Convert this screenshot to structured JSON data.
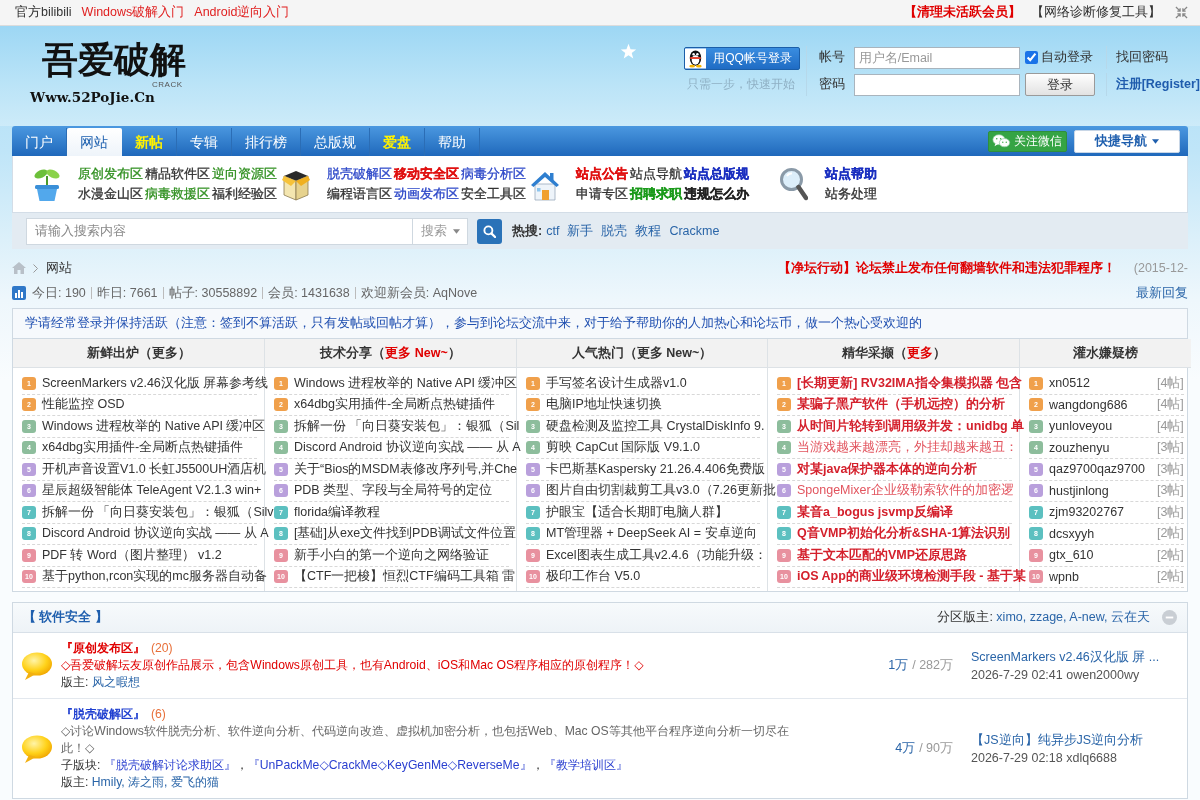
{
  "top_bar": {
    "links": [
      {
        "label": "官方bilibili",
        "color": "#333333"
      },
      {
        "label": "Windows破解入门",
        "color": "#e02020"
      },
      {
        "label": "Android逆向入门",
        "color": "#e02020"
      }
    ],
    "tools": [
      {
        "label": "【清理未活跃会员】",
        "color": "#e00000",
        "bold": true
      },
      {
        "label": "【网络诊断修复工具】",
        "color": "#333333",
        "bold": false
      }
    ]
  },
  "logo": {
    "title": "吾爱破解",
    "tag": "CRACK",
    "domain": "Www.52PoJie.Cn"
  },
  "qq_login": {
    "button": "用QQ帐号登录",
    "hint": "只需一步，快速开始"
  },
  "login": {
    "account_label": "帐号",
    "account_placeholder": "用户名/Email",
    "remember": {
      "label": "自动登录",
      "checked": true
    },
    "forgot": "找回密码",
    "password_label": "密码",
    "submit": "登录",
    "register": "注册[Register]"
  },
  "nav": {
    "items": [
      {
        "label": "门户",
        "selected": false,
        "highlight": false
      },
      {
        "label": "网站",
        "selected": true,
        "highlight": false
      },
      {
        "label": "新帖",
        "selected": false,
        "highlight": true
      },
      {
        "label": "专辑",
        "selected": false,
        "highlight": false
      },
      {
        "label": "排行榜",
        "selected": false,
        "highlight": false
      },
      {
        "label": "总版规",
        "selected": false,
        "highlight": false
      },
      {
        "label": "爱盘",
        "selected": false,
        "highlight": true
      },
      {
        "label": "帮助",
        "selected": false,
        "highlight": false
      }
    ],
    "wechat": "关注微信",
    "quick_nav": "快捷导航"
  },
  "categories": [
    {
      "rows": [
        [
          {
            "label": "原创发布区",
            "color": "#2f8f1f",
            "bold": false
          },
          {
            "label": "精品软件区",
            "color": "#333333",
            "bold": false
          },
          {
            "label": "逆向资源区",
            "color": "#2f8f1f",
            "bold": false
          }
        ],
        [
          {
            "label": "水漫金山区",
            "color": "#333333",
            "bold": false
          },
          {
            "label": "病毒救援区",
            "color": "#2f8f1f",
            "bold": false
          },
          {
            "label": "福利经验区",
            "color": "#333333",
            "bold": false
          }
        ]
      ]
    },
    {
      "rows": [
        [
          {
            "label": "脱壳破解区",
            "color": "#2b46c8",
            "bold": false
          },
          {
            "label": "移动安全区",
            "color": "#e01010",
            "bold": true
          },
          {
            "label": "病毒分析区",
            "color": "#2b46c8",
            "bold": false
          }
        ],
        [
          {
            "label": "编程语言区",
            "color": "#333333",
            "bold": false
          },
          {
            "label": "动画发布区",
            "color": "#2b46c8",
            "bold": false
          },
          {
            "label": "安全工具区",
            "color": "#333333",
            "bold": false
          }
        ]
      ]
    },
    {
      "rows": [
        [
          {
            "label": "站点公告",
            "color": "#e01010",
            "bold": true
          },
          {
            "label": "站点导航",
            "color": "#333333",
            "bold": false
          },
          {
            "label": "站点总版规",
            "color": "#1a2fc0",
            "bold": true
          }
        ],
        [
          {
            "label": "申请专区",
            "color": "#333333",
            "bold": false
          },
          {
            "label": "招聘求职",
            "color": "#1a9a1a",
            "bold": true
          },
          {
            "label": "违规怎么办",
            "color": "#222222",
            "bold": true
          }
        ]
      ]
    },
    {
      "rows": [
        [
          {
            "label": "站点帮助",
            "color": "#1a2fc0",
            "bold": true
          }
        ],
        [
          {
            "label": "站务处理",
            "color": "#333333",
            "bold": false
          }
        ]
      ]
    }
  ],
  "search": {
    "placeholder": "请输入搜索内容",
    "scope": "搜索",
    "hot_label": "热搜:",
    "hot_links": [
      "ctf",
      "新手",
      "脱壳",
      "教程",
      "Crackme"
    ]
  },
  "breadcrumb": {
    "items": [
      "网站"
    ],
    "notice": "【净坛行动】论坛禁止发布任何翻墙软件和违法犯罪程序！",
    "notice_date": "(2015-12-"
  },
  "stats": {
    "items": [
      "今日: 190",
      "昨日: 7661",
      "帖子: 30558892",
      "会员: 1431638",
      "欢迎新会员: AqNove"
    ],
    "latest": "最新回复"
  },
  "announcement": "学请经常登录并保持活跃（注意：签到不算活跃，只有发帖或回帖才算），参与到论坛交流中来，对于给予帮助你的人加热心和论坛币，做一个热心受欢迎的",
  "boards": [
    {
      "heading": [
        {
          "text": "新鲜出炉（更多）",
          "emphasis": false
        }
      ],
      "items": [
        {
          "rank": "1",
          "color": "#f0a04b",
          "text": "ScreenMarkers v2.46汉化版 屏幕参考线"
        },
        {
          "rank": "2",
          "color": "#f0a04b",
          "text": "性能监控 OSD"
        },
        {
          "rank": "3",
          "color": "#8dbd9c",
          "text": "Windows 进程枚举的 Native API 缓冲区"
        },
        {
          "rank": "4",
          "color": "#8dbd9c",
          "text": "x64dbg实用插件-全局断点热键插件"
        },
        {
          "rank": "5",
          "color": "#b9a0dc",
          "text": "开机声音设置V1.0 长虹J5500UH酒店机"
        },
        {
          "rank": "6",
          "color": "#b9a0dc",
          "text": "星辰超级智能体 TeleAgent V2.1.3 win+"
        },
        {
          "rank": "7",
          "color": "#5cc0c0",
          "text": "拆解一份 「向日葵安装包」：银狐（Silv"
        },
        {
          "rank": "8",
          "color": "#5cc0c0",
          "text": "Discord Android 协议逆向实战 —— 从 A"
        },
        {
          "rank": "9",
          "color": "#e8919f",
          "text": "PDF 转 Word（图片整理） v1.2"
        },
        {
          "rank": "10",
          "color": "#e8919f",
          "text": "基于python,rcon实现的mc服务器自动备"
        }
      ]
    },
    {
      "heading": [
        {
          "text": "技术分享（",
          "emphasis": false
        },
        {
          "text": "更多 New~",
          "emphasis": true
        },
        {
          "text": "）",
          "emphasis": false
        }
      ],
      "items": [
        {
          "rank": "1",
          "color": "#f0a04b",
          "text": "Windows 进程枚举的 Native API 缓冲区"
        },
        {
          "rank": "2",
          "color": "#f0a04b",
          "text": "x64dbg实用插件-全局断点热键插件"
        },
        {
          "rank": "3",
          "color": "#8dbd9c",
          "text": "拆解一份 「向日葵安装包」：银狐（Sil"
        },
        {
          "rank": "4",
          "color": "#8dbd9c",
          "text": "Discord Android 协议逆向实战 —— 从 A"
        },
        {
          "rank": "5",
          "color": "#b9a0dc",
          "text": "关于“Bios的MSDM表修改序列号,并Che"
        },
        {
          "rank": "6",
          "color": "#b9a0dc",
          "text": "PDB 类型、字段与全局符号的定位"
        },
        {
          "rank": "7",
          "color": "#5cc0c0",
          "text": "florida编译教程"
        },
        {
          "rank": "8",
          "color": "#5cc0c0",
          "text": "[基础]从exe文件找到PDB调试文件位置"
        },
        {
          "rank": "9",
          "color": "#e8919f",
          "text": "新手小白的第一个逆向之网络验证"
        },
        {
          "rank": "10",
          "color": "#e8919f",
          "text": "【CTF一把梭】恒烈CTF编码工具箱 雷"
        }
      ]
    },
    {
      "heading": [
        {
          "text": "人气热门（更多 New~）",
          "emphasis": false
        }
      ],
      "items": [
        {
          "rank": "1",
          "color": "#f0a04b",
          "text": "手写签名设计生成器v1.0"
        },
        {
          "rank": "2",
          "color": "#f0a04b",
          "text": "电脑IP地址快速切换"
        },
        {
          "rank": "3",
          "color": "#8dbd9c",
          "text": "硬盘检测及监控工具 CrystalDiskInfo 9."
        },
        {
          "rank": "4",
          "color": "#8dbd9c",
          "text": "剪映 CapCut 国际版 V9.1.0"
        },
        {
          "rank": "5",
          "color": "#b9a0dc",
          "text": "卡巴斯基Kaspersky 21.26.4.406免费版"
        },
        {
          "rank": "6",
          "color": "#b9a0dc",
          "text": "图片自由切割裁剪工具v3.0（7.26更新批"
        },
        {
          "rank": "7",
          "color": "#5cc0c0",
          "text": "护眼宝【适合长期盯电脑人群】"
        },
        {
          "rank": "8",
          "color": "#5cc0c0",
          "text": "MT管理器 + DeepSeek AI = 安卓逆向"
        },
        {
          "rank": "9",
          "color": "#e8919f",
          "text": "Excel图表生成工具v2.4.6（功能升级："
        },
        {
          "rank": "10",
          "color": "#e8919f",
          "text": "极印工作台 V5.0"
        }
      ]
    },
    {
      "heading": [
        {
          "text": "精华采撷（",
          "emphasis": false
        },
        {
          "text": "更多",
          "emphasis": true
        },
        {
          "text": "）",
          "emphasis": false
        }
      ],
      "items": [
        {
          "rank": "1",
          "color": "#f0a04b",
          "text": "[长期更新] RV32IMA指令集模拟器 包含",
          "bold": true
        },
        {
          "rank": "2",
          "color": "#f0a04b",
          "text": "某骗子黑产软件（手机远控）的分析",
          "bold": true
        },
        {
          "rank": "3",
          "color": "#8dbd9c",
          "text": "从时间片轮转到调用级并发：unidbg 单",
          "bold": true
        },
        {
          "rank": "4",
          "color": "#8dbd9c",
          "text": "当游戏越来越漂亮，外挂却越来越丑：",
          "bold": false
        },
        {
          "rank": "5",
          "color": "#b9a0dc",
          "text": "对某java保护器本体的逆向分析",
          "bold": true
        },
        {
          "rank": "6",
          "color": "#b9a0dc",
          "text": "SpongeMixer企业级勒索软件的加密逻",
          "bold": false
        },
        {
          "rank": "7",
          "color": "#5cc0c0",
          "text": "某音a_bogus jsvmp反编译",
          "bold": true
        },
        {
          "rank": "8",
          "color": "#5cc0c0",
          "text": "Q音VMP初始化分析&SHA-1算法识别",
          "bold": true
        },
        {
          "rank": "9",
          "color": "#e8919f",
          "text": "基于文本匹配的VMP还原思路",
          "bold": true
        },
        {
          "rank": "10",
          "color": "#e8919f",
          "text": "iOS App的商业级环境检测手段 - 基于某",
          "bold": true
        }
      ]
    },
    {
      "heading": [
        {
          "text": "灌水嫌疑榜",
          "emphasis": false
        }
      ],
      "items": [
        {
          "rank": "1",
          "color": "#f0a04b",
          "text": "xn0512",
          "count": "[4帖]"
        },
        {
          "rank": "2",
          "color": "#f0a04b",
          "text": "wangdong686",
          "count": "[4帖]"
        },
        {
          "rank": "3",
          "color": "#8dbd9c",
          "text": "yunloveyou",
          "count": "[4帖]"
        },
        {
          "rank": "4",
          "color": "#8dbd9c",
          "text": "zouzhenyu",
          "count": "[3帖]"
        },
        {
          "rank": "5",
          "color": "#b9a0dc",
          "text": "qaz9700qaz9700",
          "count": "[3帖]"
        },
        {
          "rank": "6",
          "color": "#b9a0dc",
          "text": "hustjinlong",
          "count": "[3帖]"
        },
        {
          "rank": "7",
          "color": "#5cc0c0",
          "text": "zjm93202767",
          "count": "[3帖]"
        },
        {
          "rank": "8",
          "color": "#5cc0c0",
          "text": "dcsxyyh",
          "count": "[2帖]"
        },
        {
          "rank": "9",
          "color": "#e8919f",
          "text": "gtx_610",
          "count": "[2帖]"
        },
        {
          "rank": "10",
          "color": "#e8919f",
          "text": "wpnb",
          "count": "[2帖]"
        }
      ]
    }
  ],
  "section": {
    "title": "【 软件安全 】",
    "moderators_label": "分区版主:",
    "moderators": "ximo, zzage, A-new, 云在天",
    "forums": [
      {
        "title": "『原创发布区』",
        "count": "(20)",
        "highlight": true,
        "description": "◇吾爱破解坛友原创作品展示，包含Windows原创工具，也有Android、iOS和Mac OS程序相应的原创程序！◇",
        "moderators_label": "版主:",
        "moderators": "风之暇想",
        "threads": "1万",
        "posts": "/ 282万",
        "last_post": "ScreenMarkers v2.46汉化版 屏 ...",
        "last_meta": "2026-7-29 02:41 owen2000wy"
      },
      {
        "title": "『脱壳破解区』",
        "count": "(6)",
        "highlight": false,
        "description": "◇讨论Windows软件脱壳分析、软件逆向分析、代码逆向改造、虚拟机加密分析，也包括Web、Mac OS等其他平台程序逆向分析一切尽在此！◇",
        "subforums": {
          "label": "子版块:",
          "parts": [
            {
              "text": "『脱壳破解讨论求助区』",
              "link": true
            },
            {
              "text": "，",
              "link": false
            },
            {
              "text": "『UnPackMe◇CrackMe◇KeyGenMe◇ReverseMe』",
              "link": true
            },
            {
              "text": "，",
              "link": false
            },
            {
              "text": "『教学培训区』",
              "link": true
            }
          ]
        },
        "moderators_label": "版主:",
        "moderators": "Hmily, 涛之雨, 爱飞的猫",
        "threads": "4万",
        "posts": "/ 90万",
        "last_post": "【JS逆向】纯异步JS逆向分析",
        "last_meta": "2026-7-29 02:18 xdlq6688"
      }
    ]
  }
}
